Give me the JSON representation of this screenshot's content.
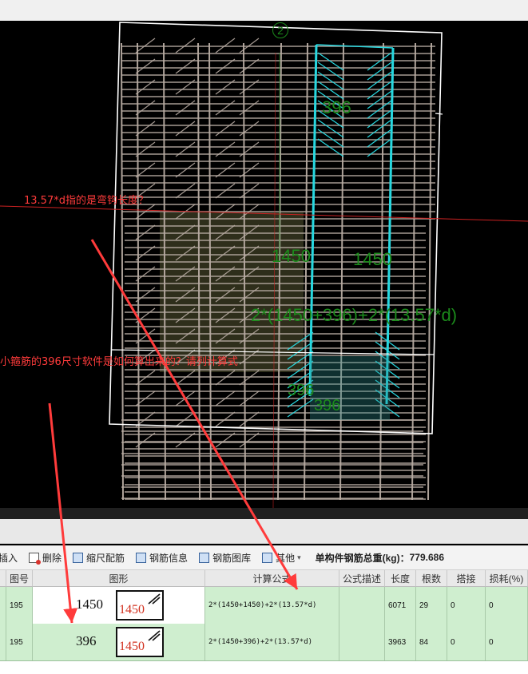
{
  "viewport": {
    "axis_label": "2",
    "dims": {
      "top_396": "396",
      "left_1450": "1450",
      "right_1450": "1450",
      "formula": "2*(1450+396)+2*(13.57*d)",
      "bottom_396_a": "396",
      "bottom_396_b": "396"
    },
    "annotations": {
      "hook_question": "13.57*d指的是弯钩长度？",
      "stirrup_question": "小箍筋的396尺寸软件是如何算出来的？请列计算式"
    }
  },
  "toolbar": {
    "insert": "插入",
    "delete": "删除",
    "scale": "缩尺配筋",
    "info": "钢筋信息",
    "library": "钢筋图库",
    "other": "其他",
    "weight_label": "单构件钢筋总重(kg)：",
    "weight_value": "779.686"
  },
  "table": {
    "headers": [
      "图号",
      "图形",
      "计算公式",
      "公式描述",
      "长度",
      "根数",
      "搭接",
      "损耗(%)"
    ],
    "rows": [
      {
        "fig_no": "195",
        "dim_text": "1450",
        "shape_num": "1450",
        "formula": "2*(1450+1450)+2*(13.57*d)",
        "desc": "",
        "length": "6071",
        "count": "29",
        "lap": "0",
        "loss": "0"
      },
      {
        "fig_no": "195",
        "dim_text": "396",
        "shape_num": "1450",
        "formula": "2*(1450+396)+2*(13.57*d)",
        "desc": "",
        "length": "3963",
        "count": "84",
        "lap": "0",
        "loss": "0"
      }
    ]
  },
  "colors": {
    "highlight": "#27d8e0",
    "rebar": "#b7aba2",
    "dimension": "#1b8a1b",
    "annotation": "#ff3b3b",
    "row_bg": "#cfeecf"
  }
}
